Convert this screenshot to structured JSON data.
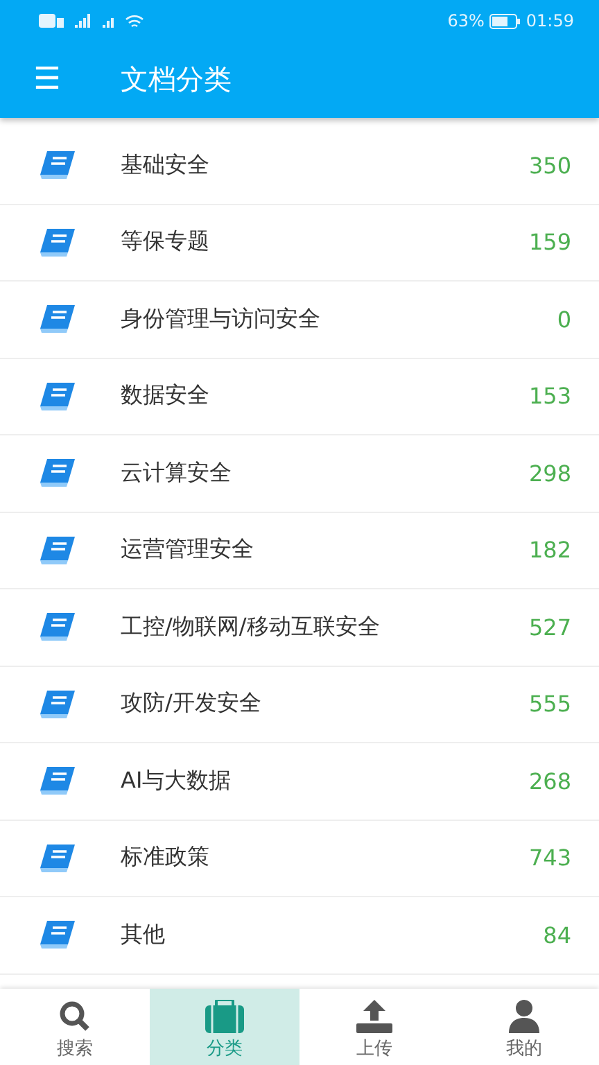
{
  "status_bar": {
    "battery": "63%",
    "time": "01:59"
  },
  "app_bar": {
    "menu": "☰",
    "title": "文档分类"
  },
  "categories": [
    {
      "name": "基础安全",
      "count": "350"
    },
    {
      "name": "等保专题",
      "count": "159"
    },
    {
      "name": "身份管理与访问安全",
      "count": "0"
    },
    {
      "name": "数据安全",
      "count": "153"
    },
    {
      "name": "云计算安全",
      "count": "298"
    },
    {
      "name": "运营管理安全",
      "count": "182"
    },
    {
      "name": "工控/物联网/移动互联安全",
      "count": "527"
    },
    {
      "name": "攻防/开发安全",
      "count": "555"
    },
    {
      "name": "AI与大数据",
      "count": "268"
    },
    {
      "name": "标准政策",
      "count": "743"
    },
    {
      "name": "其他",
      "count": "84"
    }
  ],
  "bottom_nav": [
    {
      "kind": "search",
      "label": "搜索",
      "selected": false
    },
    {
      "kind": "category",
      "label": "分类",
      "selected": true
    },
    {
      "kind": "upload",
      "label": "上传",
      "selected": false
    },
    {
      "kind": "profile",
      "label": "我的",
      "selected": false
    }
  ]
}
